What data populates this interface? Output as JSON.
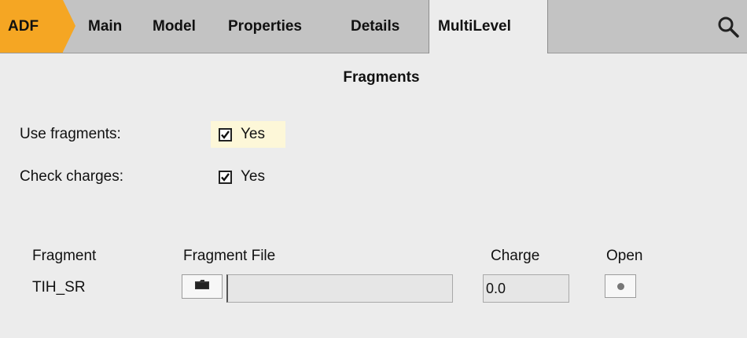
{
  "tabs": {
    "adf": "ADF",
    "items": [
      "Main",
      "Model",
      "Properties",
      "Details"
    ],
    "active": "MultiLevel"
  },
  "icons": {
    "search": "search-icon",
    "browse": "folder-icon",
    "open": "dot-icon"
  },
  "colors": {
    "adf_tab": "#f5a623",
    "highlight": "#fdf7d8",
    "tabbar": "#c3c3c3",
    "background": "#ececec"
  },
  "section": {
    "title": "Fragments"
  },
  "options": {
    "use_fragments": {
      "label": "Use fragments:",
      "value": "Yes",
      "checked": true
    },
    "check_charges": {
      "label": "Check charges:",
      "value": "Yes",
      "checked": true
    }
  },
  "table": {
    "headers": {
      "fragment": "Fragment",
      "file": "Fragment File",
      "charge": "Charge",
      "open": "Open"
    },
    "rows": [
      {
        "fragment": "TIH_SR",
        "file": "",
        "charge": "0.0"
      }
    ]
  }
}
